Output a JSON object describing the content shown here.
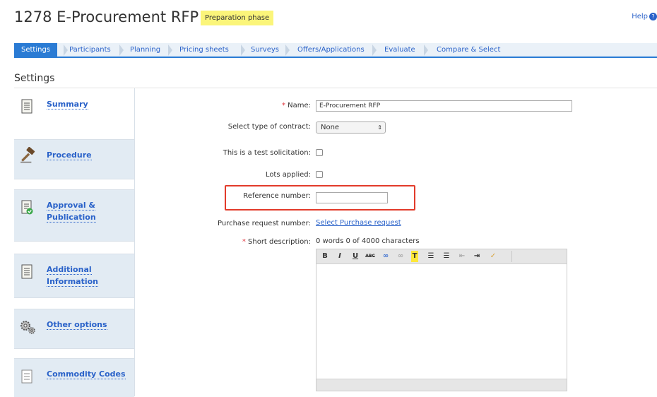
{
  "header": {
    "title": "1278 E-Procurement RFP",
    "phase_badge": "Preparation phase",
    "help_label": "Help",
    "help_icon_glyph": "?"
  },
  "tabs": [
    {
      "label": "Settings",
      "active": true
    },
    {
      "label": "Participants"
    },
    {
      "label": "Planning"
    },
    {
      "label": "Pricing sheets"
    },
    {
      "label": "Surveys"
    },
    {
      "label": "Offers/Applications"
    },
    {
      "label": "Evaluate"
    },
    {
      "label": "Compare & Select"
    }
  ],
  "section_title": "Settings",
  "sidebar": {
    "items": [
      {
        "label": "Summary",
        "icon": "document-icon"
      },
      {
        "label": "Procedure",
        "icon": "gavel-icon"
      },
      {
        "label_line1": "Approval &",
        "label_line2": "Publication",
        "icon": "approved-document-icon"
      },
      {
        "label_line1": "Additional",
        "label_line2": "Information",
        "icon": "document-icon"
      },
      {
        "label": "Other options",
        "icon": "gears-icon"
      },
      {
        "label": "Commodity Codes",
        "icon": "list-icon"
      }
    ]
  },
  "form": {
    "required_mark": "*",
    "name_label": "Name:",
    "name_value": "E-Procurement RFP",
    "contract_label": "Select type of contract:",
    "contract_value": "None",
    "contract_arrow": "⇕",
    "test_label": "This is a test solicitation:",
    "lots_label": "Lots applied:",
    "reference_label": "Reference number:",
    "reference_value": "",
    "purchase_label": "Purchase request number:",
    "purchase_link": "Select Purchase request",
    "short_desc_label": "Short description:",
    "word_count": "0 words 0 of 4000 characters"
  },
  "editor": {
    "buttons": [
      "B",
      "I",
      "U",
      "ABC",
      "∞",
      "∞",
      "T",
      "☰",
      "☰",
      "⇤",
      "⇥",
      "✓"
    ]
  },
  "colors": {
    "accent": "#2a7bd4",
    "link": "#2a62c9",
    "badge": "#fbf57a",
    "highlight": "#e23b2a"
  }
}
